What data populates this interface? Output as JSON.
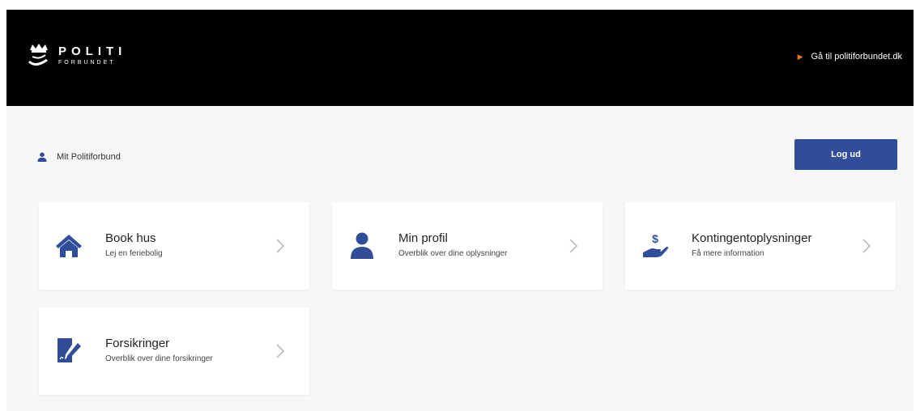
{
  "header": {
    "logo_line1": "POLITI",
    "logo_line2": "FORBUNDET",
    "external_link": "Gå til politiforbundet.dk"
  },
  "user": {
    "label": "Mit Politiforbund",
    "logout_label": "Log ud"
  },
  "cards": [
    {
      "title": "Book hus",
      "subtitle": "Lej en feriebolig",
      "icon": "house-icon"
    },
    {
      "title": "Min profil",
      "subtitle": "Overblik over dine oplysninger",
      "icon": "person-icon"
    },
    {
      "title": "Kontingentoplysninger",
      "subtitle": "Få mere information",
      "icon": "hand-dollar-icon"
    },
    {
      "title": "Forsikringer",
      "subtitle": "Overblik over dine forsikringer",
      "icon": "document-pen-icon"
    }
  ],
  "colors": {
    "header_bg": "#000000",
    "accent_blue": "#2f4d99",
    "link_arrow": "#e8731a",
    "page_bg": "#f7f7f7",
    "chevron": "#bbbbbb"
  }
}
